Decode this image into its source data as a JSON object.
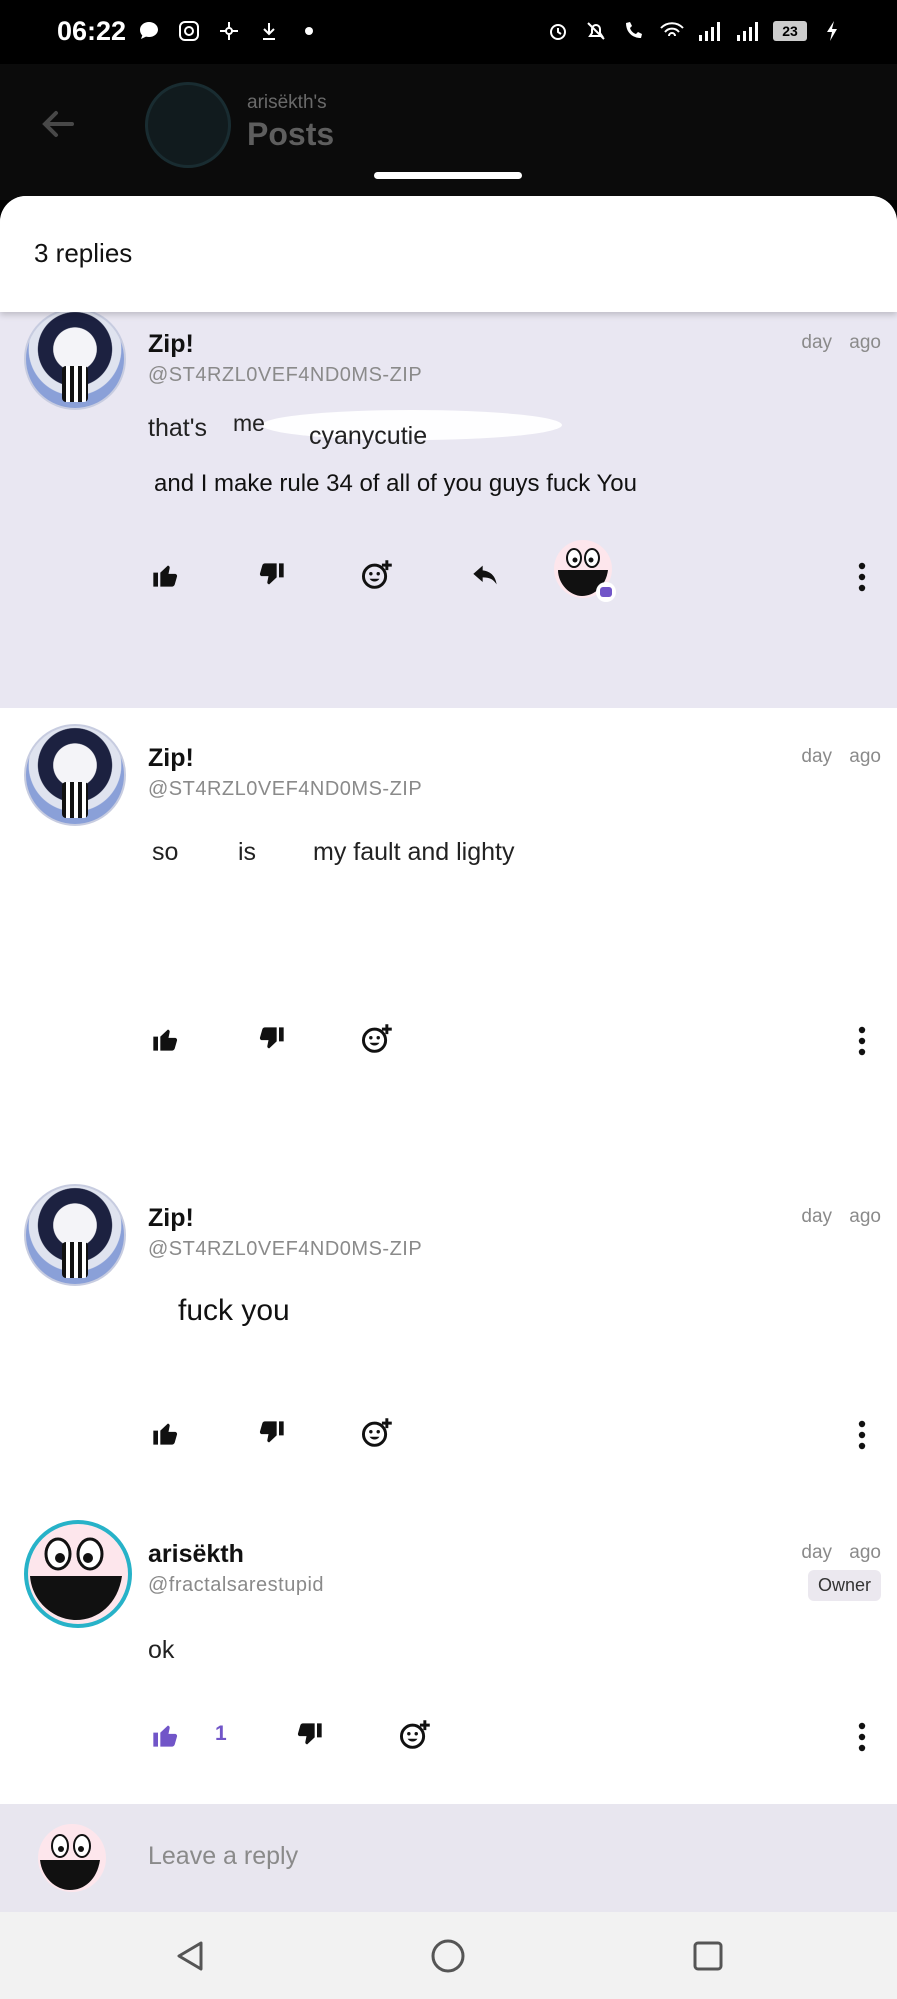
{
  "status_bar": {
    "time": "06:22",
    "battery": "23"
  },
  "header": {
    "owner_label": "arisëkth's",
    "title": "Posts"
  },
  "sheet": {
    "title": "3 replies"
  },
  "replies": [
    {
      "name": "Zip!",
      "handle": "@ST4RZL0VEF4ND0MS-ZIP",
      "time": "day ago",
      "text_parts": [
        "that's",
        "me",
        "cyanycutie"
      ],
      "text2": "and I make rule 34 of all of you guys fuck You",
      "highlighted": true
    },
    {
      "name": "Zip!",
      "handle": "@ST4RZL0VEF4ND0MS-ZIP",
      "time": "day ago",
      "text_parts": [
        "so",
        "is",
        "my fault and lighty"
      ]
    },
    {
      "name": "Zip!",
      "handle": "@ST4RZL0VEF4ND0MS-ZIP",
      "time": "day ago",
      "text": "fuck you"
    },
    {
      "name": "arisëkth",
      "handle": "@fractalsarestupid",
      "time": "day ago",
      "badge": "Owner",
      "text": "ok",
      "like_count": "1"
    }
  ],
  "reply_bar": {
    "placeholder": "Leave a reply"
  },
  "colors": {
    "accent": "#7155c8",
    "highlight_bg": "#e9e7f2",
    "owner_ring": "#27b2c8"
  },
  "icons": [
    "back-arrow-icon",
    "thumbs-up-icon",
    "thumbs-down-icon",
    "add-reaction-icon",
    "reply-icon",
    "more-vert-icon",
    "nav-back-icon",
    "nav-home-icon",
    "nav-recents-icon"
  ]
}
